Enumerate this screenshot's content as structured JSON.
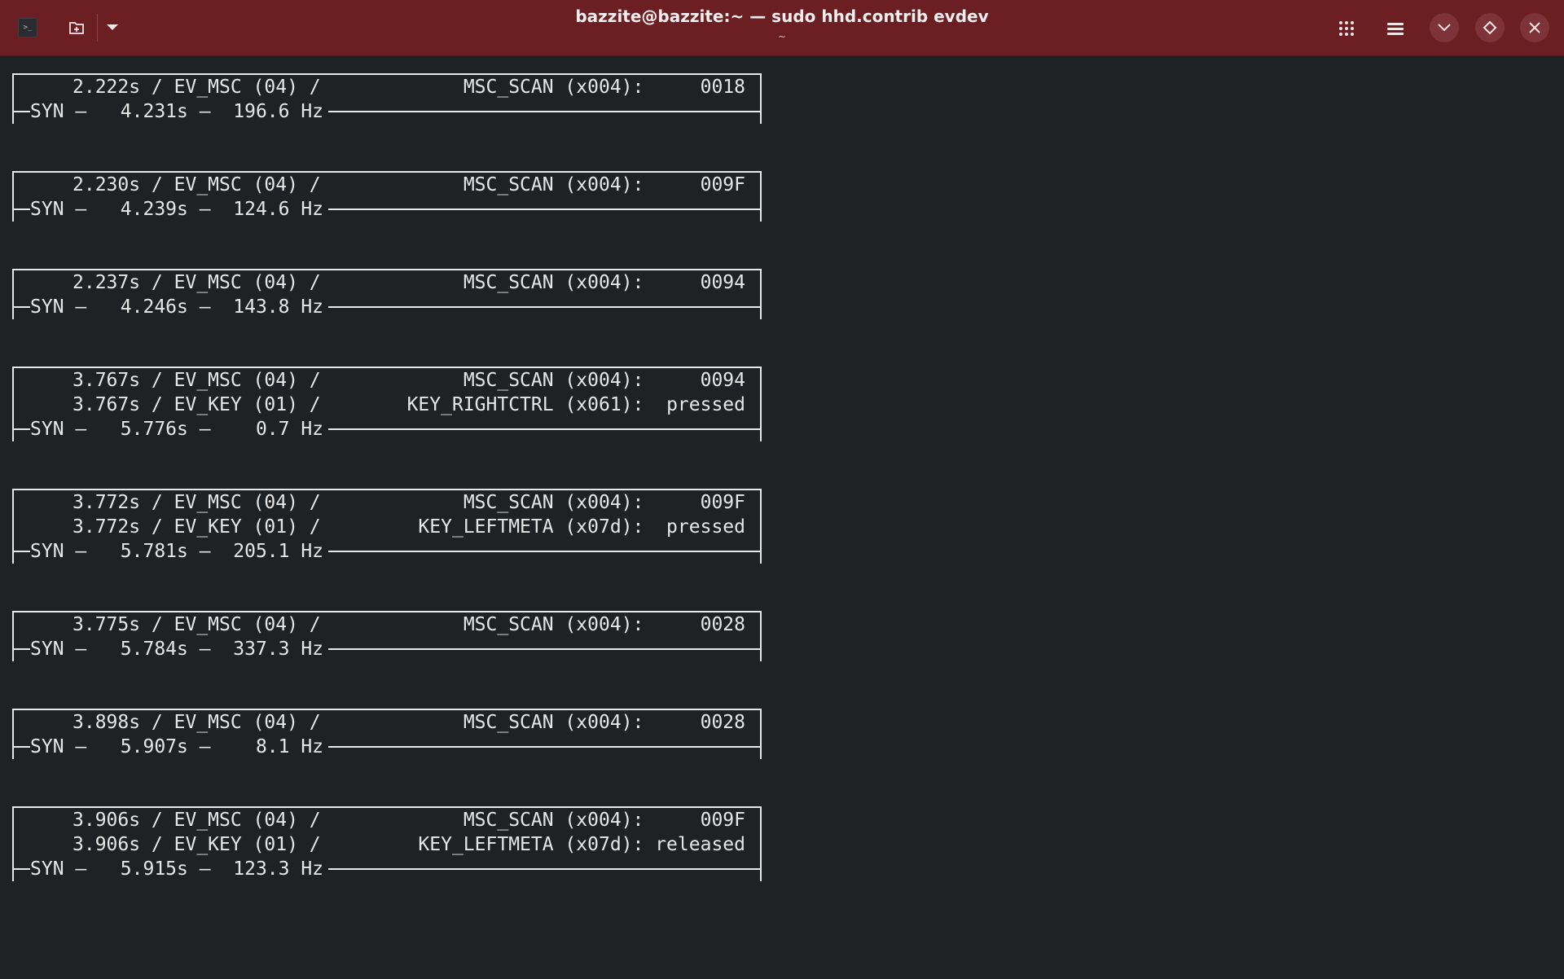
{
  "window": {
    "title": "bazzite@bazzite:~ — sudo hhd.contrib evdev",
    "subtitle": "~",
    "icons": {
      "terminal": "terminal-icon",
      "new_tab": "new-tab-icon",
      "dropdown": "chevron-down-icon",
      "grid": "grid-icon",
      "menu": "hamburger-menu-icon",
      "minimize": "minimize-icon",
      "maximize": "maximize-icon",
      "close": "close-icon"
    },
    "colors": {
      "titlebar": "#6b1f23",
      "background": "#1f2224",
      "text": "#e6e6e6"
    }
  },
  "events": [
    {
      "rows": [
        {
          "left": "2.222s / EV_MSC (04) /",
          "right": "MSC_SCAN (x004):     0018"
        }
      ],
      "syn": "SYN —   4.231s —  196.6 Hz"
    },
    {
      "rows": [
        {
          "left": "2.230s / EV_MSC (04) /",
          "right": "MSC_SCAN (x004):     009F"
        }
      ],
      "syn": "SYN —   4.239s —  124.6 Hz"
    },
    {
      "rows": [
        {
          "left": "2.237s / EV_MSC (04) /",
          "right": "MSC_SCAN (x004):     0094"
        }
      ],
      "syn": "SYN —   4.246s —  143.8 Hz"
    },
    {
      "rows": [
        {
          "left": "3.767s / EV_MSC (04) /",
          "right": "MSC_SCAN (x004):     0094"
        },
        {
          "left": "3.767s / EV_KEY (01) /",
          "right": "KEY_RIGHTCTRL (x061):  pressed"
        }
      ],
      "syn": "SYN —   5.776s —    0.7 Hz"
    },
    {
      "rows": [
        {
          "left": "3.772s / EV_MSC (04) /",
          "right": "MSC_SCAN (x004):     009F"
        },
        {
          "left": "3.772s / EV_KEY (01) /",
          "right": "KEY_LEFTMETA (x07d):  pressed"
        }
      ],
      "syn": "SYN —   5.781s —  205.1 Hz"
    },
    {
      "rows": [
        {
          "left": "3.775s / EV_MSC (04) /",
          "right": "MSC_SCAN (x004):     0028"
        }
      ],
      "syn": "SYN —   5.784s —  337.3 Hz"
    },
    {
      "rows": [
        {
          "left": "3.898s / EV_MSC (04) /",
          "right": "MSC_SCAN (x004):     0028"
        }
      ],
      "syn": "SYN —   5.907s —    8.1 Hz"
    },
    {
      "rows": [
        {
          "left": "3.906s / EV_MSC (04) /",
          "right": "MSC_SCAN (x004):     009F"
        },
        {
          "left": "3.906s / EV_KEY (01) /",
          "right": "KEY_LEFTMETA (x07d): released"
        }
      ],
      "syn": "SYN —   5.915s —  123.3 Hz"
    }
  ]
}
